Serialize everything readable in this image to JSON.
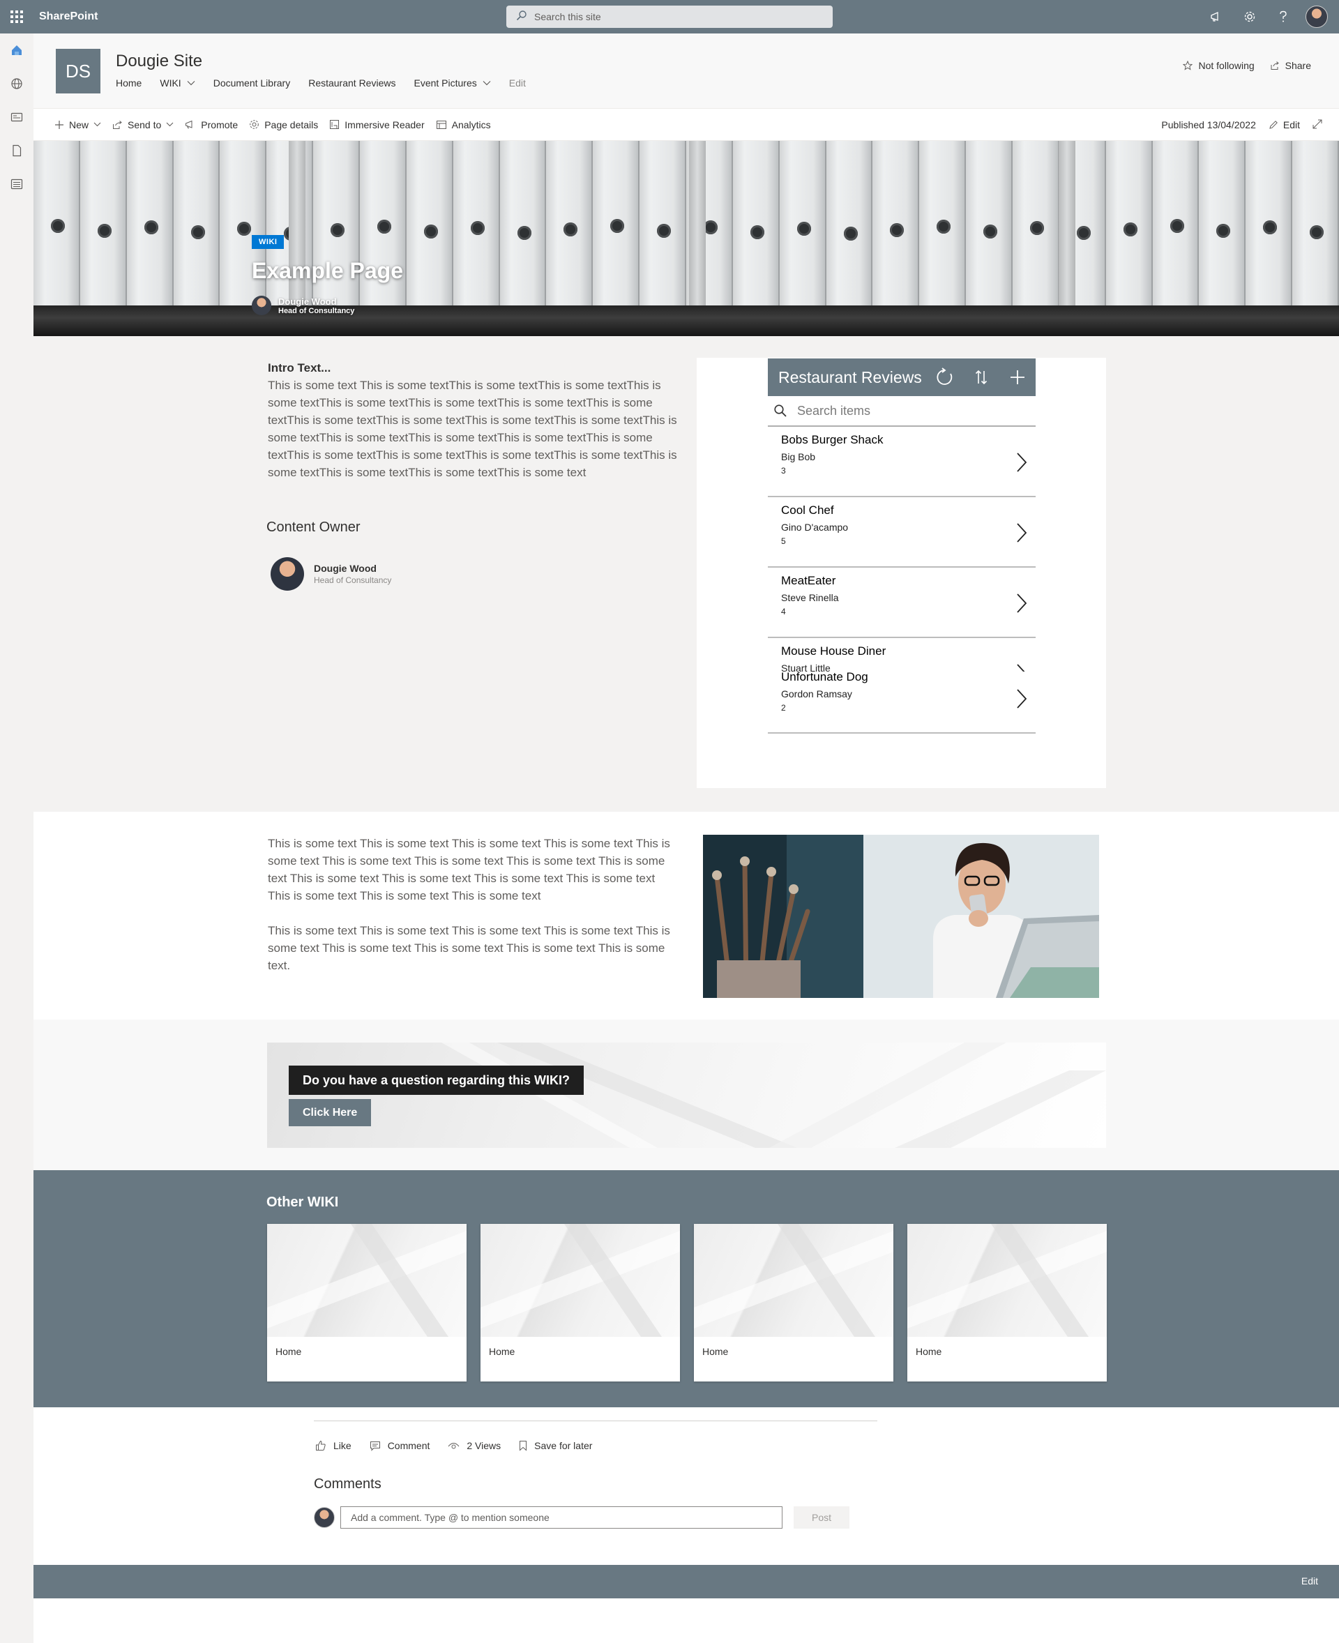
{
  "suite": {
    "title": "SharePoint",
    "search_placeholder": "Search this site"
  },
  "site": {
    "logo_text": "DS",
    "title": "Dougie Site",
    "nav": [
      {
        "label": "Home"
      },
      {
        "label": "WIKI"
      },
      {
        "label": "Document Library"
      },
      {
        "label": "Restaurant Reviews"
      },
      {
        "label": "Event Pictures"
      }
    ],
    "nav_edit": "Edit",
    "follow_label": "Not following",
    "share_label": "Share"
  },
  "commandbar": {
    "new_label": "New",
    "send_label": "Send to",
    "promote_label": "Promote",
    "details_label": "Page details",
    "reader_label": "Immersive Reader",
    "analytics_label": "Analytics",
    "published": "Published 13/04/2022",
    "edit_label": "Edit"
  },
  "hero": {
    "tag": "WIKI",
    "title": "Example Page",
    "author_name": "Dougie Wood",
    "author_role": "Head of Consultancy"
  },
  "intro": {
    "heading": "Intro Text...",
    "body": "This is some text This is some textThis is some textThis is some textThis is some textThis is some textThis is some textThis is some textThis is some textThis is some textThis is some textThis is some textThis is some textThis is some textThis is some textThis is some textThis is some textThis is some textThis is some textThis is some textThis is some textThis is some textThis is some textThis is some textThis is some textThis is some text",
    "owner_heading": "Content Owner",
    "owner_name": "Dougie Wood",
    "owner_role": "Head of Consultancy"
  },
  "restaurant_app": {
    "title": "Restaurant Reviews",
    "search_placeholder": "Search items",
    "items": [
      {
        "name": "Bobs Burger Shack",
        "owner": "Big Bob",
        "rating": "3"
      },
      {
        "name": "Cool Chef",
        "owner": "Gino D'acampo",
        "rating": "5"
      },
      {
        "name": "MeatEater",
        "owner": "Steve Rinella",
        "rating": "4"
      }
    ],
    "overlap_a": {
      "name": "Mouse House Diner",
      "owner": "Stuart Little"
    },
    "overlap_b": {
      "name": "Unfortunate Dog",
      "owner": "Gordon Ramsay",
      "rating": "2"
    }
  },
  "section2": {
    "para1": "This is some text This is some text This is some text This is some text This is some text This is some text This is some text This is some text This is some text This is some text This is some text This is some text This is some text This is some text This is some text This is some text",
    "para2": "This is some text This is some text This is some text This is some text This is some text This is some text This is some text This is some text This is some text."
  },
  "cta": {
    "question": "Do you have a question regarding this WIKI?",
    "button": "Click Here"
  },
  "other_wiki": {
    "title": "Other WIKI",
    "cards": [
      {
        "label": "Home"
      },
      {
        "label": "Home"
      },
      {
        "label": "Home"
      },
      {
        "label": "Home"
      }
    ]
  },
  "social": {
    "like": "Like",
    "comment": "Comment",
    "views": "2 Views",
    "save": "Save for later",
    "comments_title": "Comments",
    "comment_placeholder": "Add a comment. Type @ to mention someone",
    "post": "Post"
  },
  "footer": {
    "edit": "Edit"
  },
  "colors": {
    "theme": "#687882",
    "accent": "#0078d4",
    "section_bg": "#f3f2f1"
  }
}
